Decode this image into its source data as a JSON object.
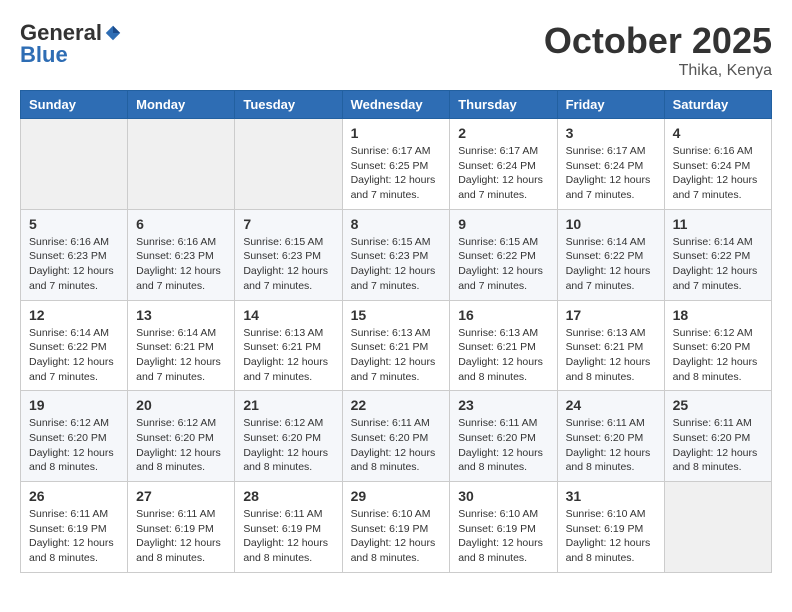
{
  "logo": {
    "general": "General",
    "blue": "Blue"
  },
  "header": {
    "month": "October 2025",
    "location": "Thika, Kenya"
  },
  "days_of_week": [
    "Sunday",
    "Monday",
    "Tuesday",
    "Wednesday",
    "Thursday",
    "Friday",
    "Saturday"
  ],
  "weeks": [
    [
      {
        "day": "",
        "info": ""
      },
      {
        "day": "",
        "info": ""
      },
      {
        "day": "",
        "info": ""
      },
      {
        "day": "1",
        "info": "Sunrise: 6:17 AM\nSunset: 6:25 PM\nDaylight: 12 hours and 7 minutes."
      },
      {
        "day": "2",
        "info": "Sunrise: 6:17 AM\nSunset: 6:24 PM\nDaylight: 12 hours and 7 minutes."
      },
      {
        "day": "3",
        "info": "Sunrise: 6:17 AM\nSunset: 6:24 PM\nDaylight: 12 hours and 7 minutes."
      },
      {
        "day": "4",
        "info": "Sunrise: 6:16 AM\nSunset: 6:24 PM\nDaylight: 12 hours and 7 minutes."
      }
    ],
    [
      {
        "day": "5",
        "info": "Sunrise: 6:16 AM\nSunset: 6:23 PM\nDaylight: 12 hours and 7 minutes."
      },
      {
        "day": "6",
        "info": "Sunrise: 6:16 AM\nSunset: 6:23 PM\nDaylight: 12 hours and 7 minutes."
      },
      {
        "day": "7",
        "info": "Sunrise: 6:15 AM\nSunset: 6:23 PM\nDaylight: 12 hours and 7 minutes."
      },
      {
        "day": "8",
        "info": "Sunrise: 6:15 AM\nSunset: 6:23 PM\nDaylight: 12 hours and 7 minutes."
      },
      {
        "day": "9",
        "info": "Sunrise: 6:15 AM\nSunset: 6:22 PM\nDaylight: 12 hours and 7 minutes."
      },
      {
        "day": "10",
        "info": "Sunrise: 6:14 AM\nSunset: 6:22 PM\nDaylight: 12 hours and 7 minutes."
      },
      {
        "day": "11",
        "info": "Sunrise: 6:14 AM\nSunset: 6:22 PM\nDaylight: 12 hours and 7 minutes."
      }
    ],
    [
      {
        "day": "12",
        "info": "Sunrise: 6:14 AM\nSunset: 6:22 PM\nDaylight: 12 hours and 7 minutes."
      },
      {
        "day": "13",
        "info": "Sunrise: 6:14 AM\nSunset: 6:21 PM\nDaylight: 12 hours and 7 minutes."
      },
      {
        "day": "14",
        "info": "Sunrise: 6:13 AM\nSunset: 6:21 PM\nDaylight: 12 hours and 7 minutes."
      },
      {
        "day": "15",
        "info": "Sunrise: 6:13 AM\nSunset: 6:21 PM\nDaylight: 12 hours and 7 minutes."
      },
      {
        "day": "16",
        "info": "Sunrise: 6:13 AM\nSunset: 6:21 PM\nDaylight: 12 hours and 8 minutes."
      },
      {
        "day": "17",
        "info": "Sunrise: 6:13 AM\nSunset: 6:21 PM\nDaylight: 12 hours and 8 minutes."
      },
      {
        "day": "18",
        "info": "Sunrise: 6:12 AM\nSunset: 6:20 PM\nDaylight: 12 hours and 8 minutes."
      }
    ],
    [
      {
        "day": "19",
        "info": "Sunrise: 6:12 AM\nSunset: 6:20 PM\nDaylight: 12 hours and 8 minutes."
      },
      {
        "day": "20",
        "info": "Sunrise: 6:12 AM\nSunset: 6:20 PM\nDaylight: 12 hours and 8 minutes."
      },
      {
        "day": "21",
        "info": "Sunrise: 6:12 AM\nSunset: 6:20 PM\nDaylight: 12 hours and 8 minutes."
      },
      {
        "day": "22",
        "info": "Sunrise: 6:11 AM\nSunset: 6:20 PM\nDaylight: 12 hours and 8 minutes."
      },
      {
        "day": "23",
        "info": "Sunrise: 6:11 AM\nSunset: 6:20 PM\nDaylight: 12 hours and 8 minutes."
      },
      {
        "day": "24",
        "info": "Sunrise: 6:11 AM\nSunset: 6:20 PM\nDaylight: 12 hours and 8 minutes."
      },
      {
        "day": "25",
        "info": "Sunrise: 6:11 AM\nSunset: 6:20 PM\nDaylight: 12 hours and 8 minutes."
      }
    ],
    [
      {
        "day": "26",
        "info": "Sunrise: 6:11 AM\nSunset: 6:19 PM\nDaylight: 12 hours and 8 minutes."
      },
      {
        "day": "27",
        "info": "Sunrise: 6:11 AM\nSunset: 6:19 PM\nDaylight: 12 hours and 8 minutes."
      },
      {
        "day": "28",
        "info": "Sunrise: 6:11 AM\nSunset: 6:19 PM\nDaylight: 12 hours and 8 minutes."
      },
      {
        "day": "29",
        "info": "Sunrise: 6:10 AM\nSunset: 6:19 PM\nDaylight: 12 hours and 8 minutes."
      },
      {
        "day": "30",
        "info": "Sunrise: 6:10 AM\nSunset: 6:19 PM\nDaylight: 12 hours and 8 minutes."
      },
      {
        "day": "31",
        "info": "Sunrise: 6:10 AM\nSunset: 6:19 PM\nDaylight: 12 hours and 8 minutes."
      },
      {
        "day": "",
        "info": ""
      }
    ]
  ]
}
